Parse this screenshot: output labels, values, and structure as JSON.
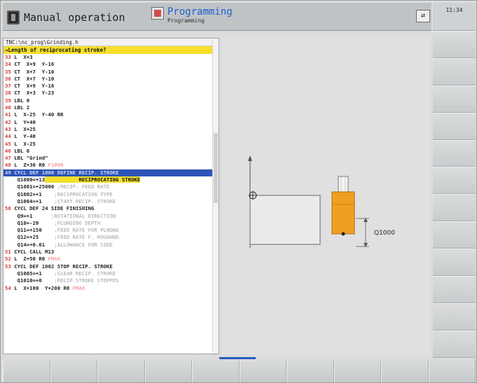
{
  "header": {
    "mode_manual": "Manual operation",
    "mode_programming": "Programming",
    "mode_programming_sub": "Programming",
    "clock": "11:34"
  },
  "program": {
    "path": "TNC:\\nc_prog\\Grinding.h",
    "prompt": "→Length of reciprocating stroke?",
    "lines": [
      {
        "n": "33",
        "t": " L  X+3"
      },
      {
        "n": "34",
        "t": " CT  X+9  Y-16"
      },
      {
        "n": "35",
        "t": " CT  X+7  Y-10"
      },
      {
        "n": "36",
        "t": " CT  X+7  Y-10"
      },
      {
        "n": "37",
        "t": " CT  X+9  Y-16"
      },
      {
        "n": "38",
        "t": " CT  X+3  Y-23"
      },
      {
        "n": "39",
        "t": " LBL 0"
      },
      {
        "n": "40",
        "t": " LBL 2"
      },
      {
        "n": "41",
        "t": " L  X-25  Y-40 RR"
      },
      {
        "n": "42",
        "t": " L  Y+40"
      },
      {
        "n": "43",
        "t": " L  X+25"
      },
      {
        "n": "44",
        "t": " L  Y-40"
      },
      {
        "n": "45",
        "t": " L  X-25"
      },
      {
        "n": "46",
        "t": " LBL 0"
      },
      {
        "n": "47",
        "t": " LBL \"Grind\""
      },
      {
        "n": "48",
        "t": " L  Z+30 R0 ",
        "r": "F1000"
      },
      {
        "n": "49",
        "t": " CYCL DEF 1000 DEFINE RECIP. STROKE",
        "sel": true
      },
      {
        "n": "",
        "t": "    Q1000=+13",
        "hl": "           RECIPROCATING STROKE"
      },
      {
        "n": "",
        "t": "    Q1001=+25000",
        "c": " ;RECIP. FEED RATE"
      },
      {
        "n": "",
        "t": "    Q1002=+1",
        "c": "    ;RECIPROCATION TYPE"
      },
      {
        "n": "",
        "t": "    Q1004=+1",
        "c": "    ;START RECIP. STROKE"
      },
      {
        "n": "50",
        "t": " CYCL DEF 24 SIDE FINISHING"
      },
      {
        "n": "",
        "t": "    Q9=+1",
        "c": "      ;ROTATIONAL DIRECTION"
      },
      {
        "n": "",
        "t": "    Q10=-20",
        "c": "     ;PLUNGING DEPTH"
      },
      {
        "n": "",
        "t": "    Q11=+150",
        "c": "    ;FEED RATE FOR PLNGNG"
      },
      {
        "n": "",
        "t": "    Q12=+25",
        "c": "     ;FEED RATE F. ROUGHNG"
      },
      {
        "n": "",
        "t": "    Q14=+0.01",
        "c": "   ;ALLOWANCE FOR SIDE"
      },
      {
        "n": "51",
        "t": " CYCL CALL M13"
      },
      {
        "n": "52",
        "t": " L  Z+50 R0 ",
        "r": "FMAX"
      },
      {
        "n": "53",
        "t": " CYCL DEF 1002 STOP RECIP. STROKE"
      },
      {
        "n": "",
        "t": "    Q1005=+1",
        "c": "    ;CLEAR RECIP. STROKE"
      },
      {
        "n": "",
        "t": "    Q1010=+0",
        "c": "    ;RECIP.STROKE STOPPOS"
      },
      {
        "n": "54",
        "t": " L  X+100  Y+200 R0 ",
        "r": "FMAX"
      }
    ]
  },
  "graphic": {
    "dimension_label": "Q1000"
  },
  "colors": {
    "selection": "#2d54b8",
    "highlight": "#f5df2a",
    "grinder": "#f0a020",
    "line_number": "#d23b3b",
    "mode_title": "#1f5fd0"
  }
}
